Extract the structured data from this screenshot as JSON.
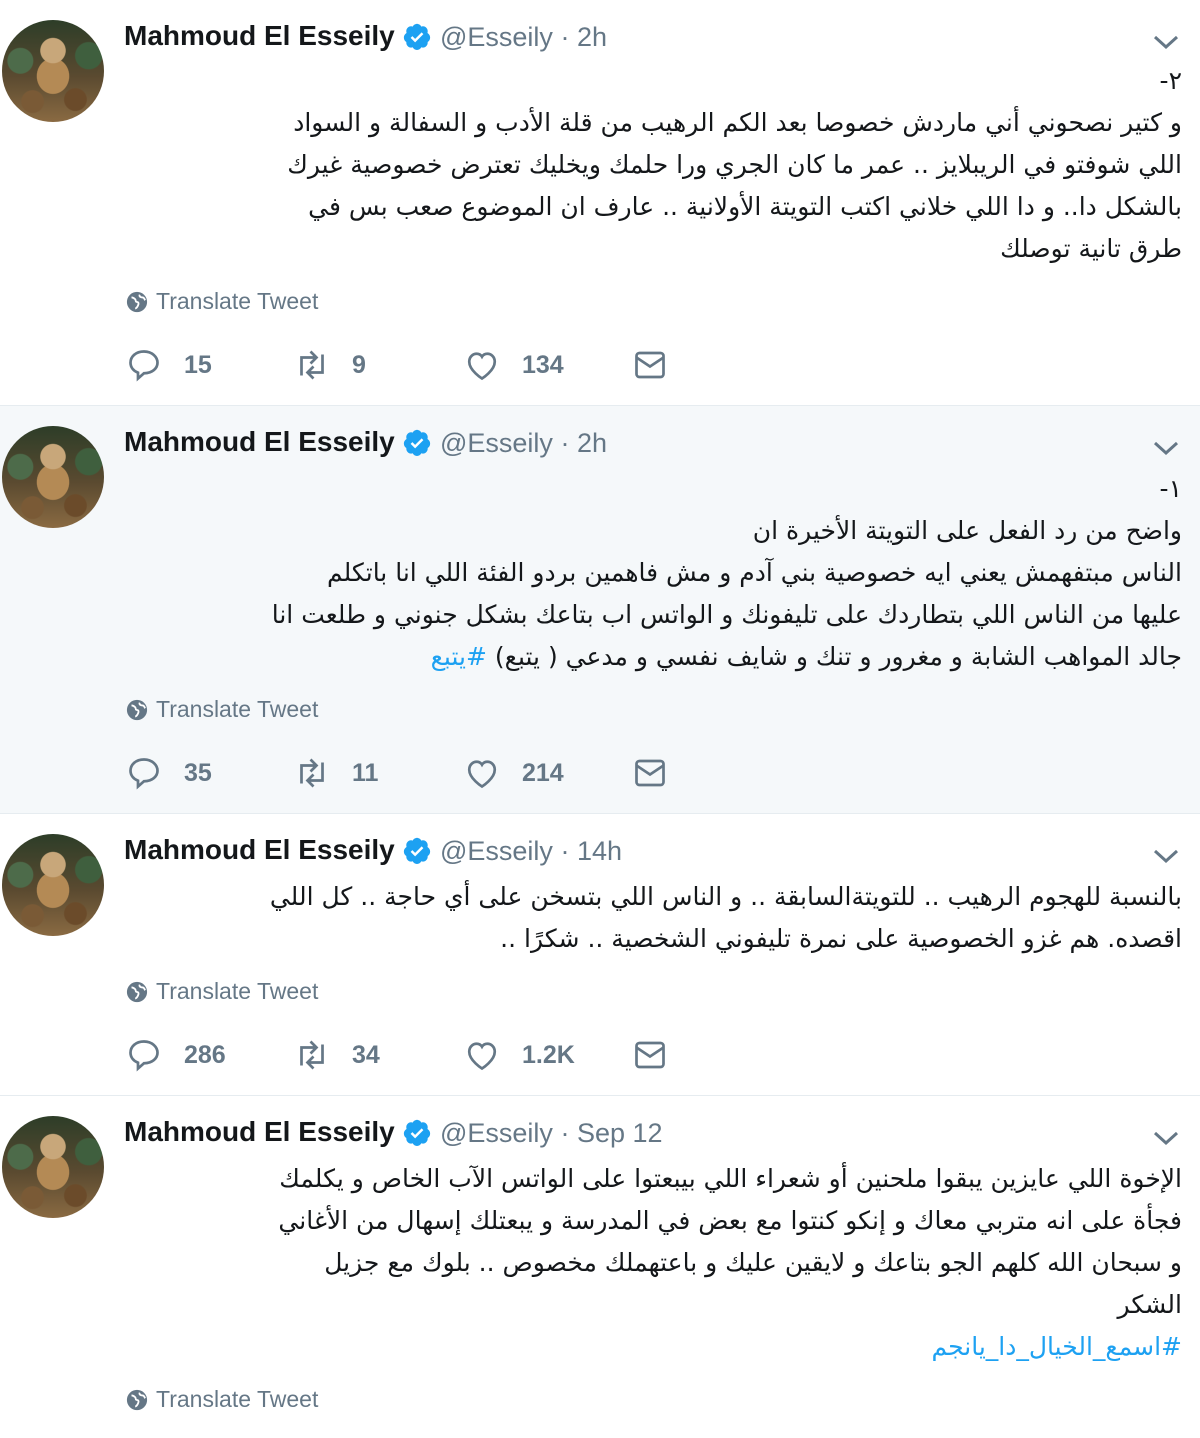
{
  "tweets": [
    {
      "name": "Mahmoud El Esseily",
      "handle": "@Esseily",
      "time": "· 2h",
      "lines": [
        "٢-",
        "و كتير نصحوني أني ماردش خصوصا بعد الكم الرهيب من قلة الأدب و السفالة و السواد",
        "اللي شوفتو في الريبلايز .. عمر ما كان الجري ورا حلمك ويخليك تعترض خصوصية غيرك",
        "بالشكل دا.. و دا اللي خلاني اكتب التويتة الأولانية .. عارف ان الموضوع صعب بس في",
        "طرق تانية توصلك"
      ],
      "translate": "Translate Tweet",
      "replies": "15",
      "retweets": "9",
      "likes": "134"
    },
    {
      "name": "Mahmoud El Esseily",
      "handle": "@Esseily",
      "time": "· 2h",
      "lines": [
        "١-",
        "واضح من رد الفعل على التويتة الأخيرة ان",
        "الناس مبتفهمش يعني ايه خصوصية بني آدم و مش فاهمين بردو الفئة اللي انا باتكلم",
        "عليها من الناس اللي بتطاردك على تليفونك و الواتس اب بتاعك بشكل جنوني و طلعت انا",
        "جالد المواهب الشابة و مغرور و تنك و شايف نفسي و مدعي ( يتبع)"
      ],
      "hashtag": "#يتبع",
      "translate": "Translate Tweet",
      "replies": "35",
      "retweets": "11",
      "likes": "214"
    },
    {
      "name": "Mahmoud El Esseily",
      "handle": "@Esseily",
      "time": "· 14h",
      "lines": [
        "بالنسبة للهجوم الرهيب .. للتويتةالسابقة .. و الناس اللي بتسخن على أي حاجة .. كل اللي",
        "اقصده. هم غزو الخصوصية على نمرة تليفوني الشخصية .. شكرًا .."
      ],
      "translate": "Translate Tweet",
      "replies": "286",
      "retweets": "34",
      "likes": "1.2K"
    },
    {
      "name": "Mahmoud El Esseily",
      "handle": "@Esseily",
      "time": "· Sep 12",
      "lines": [
        "الإخوة اللي عايزين يبقوا ملحنين أو شعراء اللي بيبعتوا على الواتس الآب الخاص و يكلمك",
        "فجأة على انه متربي معاك و إنكو كنتوا مع بعض في المدرسة و يبعتلك إسهال من الأغاني",
        "و سبحان الله كلهم الجو بتاعك و لايقين عليك و باعتهملك مخصوص .. بلوك مع جزيل",
        "الشكر"
      ],
      "hashtag": "#اسمع_الخيال_دا_يانجم",
      "translate": "Translate Tweet"
    }
  ],
  "icons": {
    "verified": "verified-badge-icon",
    "caret": "chevron-down-icon",
    "globe": "globe-icon",
    "reply": "reply-icon",
    "retweet": "retweet-icon",
    "like": "heart-icon",
    "dm": "envelope-icon"
  },
  "colors": {
    "accent": "#1da1f2",
    "muted": "#657786",
    "text": "#14171a",
    "highlight_bg": "#f5f8fa"
  }
}
